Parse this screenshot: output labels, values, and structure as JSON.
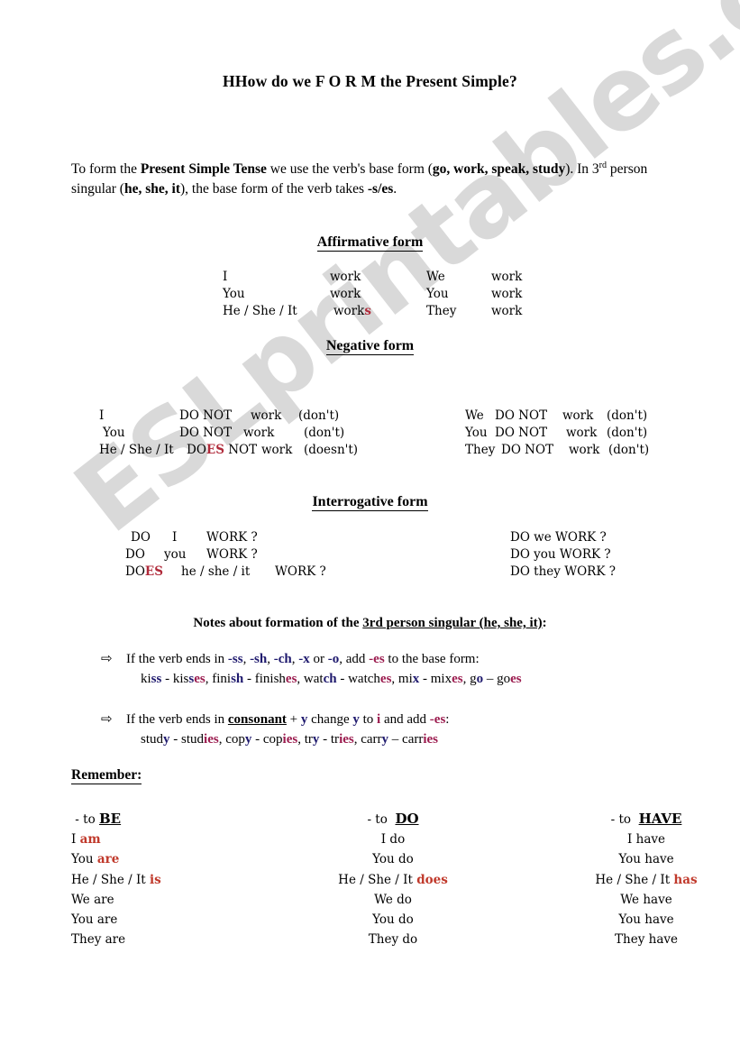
{
  "document": {
    "title": "HHow do we  F O R M  the Present Simple?",
    "watermark": "ESLprintables.com",
    "intro": {
      "part1": "To form the ",
      "bold1": "Present Simple Tense",
      "part2": " we use the verb's base form (",
      "bold2": "go, work, speak, study",
      "part3": "). In 3",
      "sup": "rd",
      "part4": " person singular (",
      "bold3": "he, she, it",
      "part5": "), the base form of the verb takes ",
      "bold4": "-s/es",
      "part6": "."
    }
  },
  "affirmative": {
    "heading": "Affirmative form",
    "left": [
      {
        "subject": "I",
        "verb": "work",
        "suffix": ""
      },
      {
        "subject": "You",
        "verb": "work",
        "suffix": ""
      },
      {
        "subject": "He / She / It",
        "verb": "work",
        "suffix": "s"
      }
    ],
    "right": [
      {
        "subject": "We",
        "verb": "work"
      },
      {
        "subject": "You",
        "verb": "work"
      },
      {
        "subject": "They",
        "verb": "work"
      }
    ]
  },
  "negative": {
    "heading": "Negative form",
    "left": [
      {
        "subject": "I",
        "aux": "DO NOT",
        "auxred": "",
        "auxtail": "",
        "verb": "work",
        "contraction": "(don't)"
      },
      {
        "subject": "You",
        "aux": "DO NOT",
        "auxred": "",
        "auxtail": "",
        "verb": "work",
        "contraction": "(don't)"
      },
      {
        "subject": "He / She / It",
        "aux": "DO",
        "auxred": "ES",
        "auxtail": " NOT",
        "verb": "work",
        "contraction": "(doesn't)"
      }
    ],
    "right": [
      {
        "subject": "We",
        "aux": "DO NOT",
        "verb": "work",
        "contraction": "(don't)"
      },
      {
        "subject": "You",
        "aux": "DO NOT",
        "verb": "work",
        "contraction": "(don't)"
      },
      {
        "subject": "They",
        "aux": "DO NOT",
        "verb": "work",
        "contraction": "(don't)"
      }
    ]
  },
  "interrogative": {
    "heading": "Interrogative form",
    "left": [
      {
        "aux": "DO",
        "auxred": "",
        "subject": "I",
        "verb": "WORK ?"
      },
      {
        "aux": "DO",
        "auxred": "",
        "subject": "you",
        "verb": "WORK ?"
      },
      {
        "aux": "DO",
        "auxred": "ES",
        "subject": "he / she / it",
        "verb": "WORK ?"
      }
    ],
    "right": [
      {
        "text": "DO we WORK ?"
      },
      {
        "text": "DO you WORK ?"
      },
      {
        "text": "DO they WORK ?"
      }
    ]
  },
  "notes": {
    "heading_plain": "Notes about formation of the ",
    "heading_underlined": "3rd person singular (he, she, it)",
    "heading_end": ":",
    "rule1": {
      "arrow": "⇨",
      "t1": "If the verb ends in ",
      "e1": "-ss",
      "t2": ", ",
      "e2": "-sh",
      "t3": ", ",
      "e3": "-ch",
      "t4": ", ",
      "e4": "-x",
      "t5": " or ",
      "e5": "-o",
      "t6": ", add ",
      "e6": "-es",
      "t7": " to the base form:",
      "examples": [
        {
          "base_start": "ki",
          "base_end": "ss",
          "sep": " - ",
          "res_start": "kis",
          "res_mid": "s",
          "res_suffix": "es",
          "tail": ", "
        },
        {
          "base_start": "fini",
          "base_end": "sh",
          "sep": " - ",
          "res_start": "finish",
          "res_mid": "",
          "res_suffix": "es",
          "tail": ", "
        },
        {
          "base_start": "wat",
          "base_end": "ch",
          "sep": " - ",
          "res_start": "watch",
          "res_mid": "",
          "res_suffix": "es",
          "tail": ", "
        },
        {
          "base_start": "mi",
          "base_end": "x",
          "sep": " - ",
          "res_start": "mix",
          "res_mid": "",
          "res_suffix": "es",
          "tail": ", "
        },
        {
          "base_start": "g",
          "base_end": "o",
          "sep": " – ",
          "res_start": "go",
          "res_mid": "",
          "res_suffix": "es",
          "tail": ""
        }
      ]
    },
    "rule2": {
      "arrow": "⇨",
      "t1": "If the verb ends in ",
      "bold_ul": "consonant",
      "t2": " + ",
      "y1": "y",
      "t3": " change ",
      "y2": "y",
      "t4": " to ",
      "i1": "i",
      "t5": " and add ",
      "e1": "-es",
      "t6": ":",
      "examples": [
        {
          "base_start": "stud",
          "base_end": "y",
          "sep": " - ",
          "res_start": "stud",
          "res_suffix": "ies",
          "tail": ", "
        },
        {
          "base_start": "cop",
          "base_end": "y",
          "sep": " - ",
          "res_start": "cop",
          "res_suffix": "ies",
          "tail": ",  "
        },
        {
          "base_start": "tr",
          "base_end": "y",
          "sep": " - ",
          "res_start": "tr",
          "res_suffix": "ies",
          "tail": ", "
        },
        {
          "base_start": "carr",
          "base_end": "y",
          "sep": " – ",
          "res_start": "carr",
          "res_suffix": "ies",
          "tail": ""
        }
      ]
    }
  },
  "remember": {
    "label": "Remember:",
    "columns": [
      {
        "head_prefix": "- to ",
        "head_verb": "BE",
        "rows": [
          {
            "subject": "I ",
            "form": "am",
            "highlight": true
          },
          {
            "subject": "You ",
            "form": "are",
            "highlight": true
          },
          {
            "subject": "He / She / It ",
            "form": "is",
            "highlight": true
          },
          {
            "subject": "We ",
            "form": "are",
            "highlight": false
          },
          {
            "subject": "You ",
            "form": "are",
            "highlight": false
          },
          {
            "subject": "They ",
            "form": "are",
            "highlight": false
          }
        ]
      },
      {
        "head_prefix": "- to  ",
        "head_verb": "DO",
        "rows": [
          {
            "subject": "I ",
            "form": "do",
            "highlight": false
          },
          {
            "subject": "You ",
            "form": "do",
            "highlight": false
          },
          {
            "subject": "He / She / It ",
            "form": "does",
            "highlight": true
          },
          {
            "subject": "We ",
            "form": "do",
            "highlight": false
          },
          {
            "subject": "You ",
            "form": "do",
            "highlight": false
          },
          {
            "subject": "They ",
            "form": "do",
            "highlight": false
          }
        ]
      },
      {
        "head_prefix": "- to  ",
        "head_verb": "HAVE",
        "rows": [
          {
            "subject": "I ",
            "form": "have",
            "highlight": false
          },
          {
            "subject": "You ",
            "form": "have",
            "highlight": false
          },
          {
            "subject": "He / She / It ",
            "form": "has",
            "highlight": true
          },
          {
            "subject": "We ",
            "form": "have",
            "highlight": false
          },
          {
            "subject": "You ",
            "form": "have",
            "highlight": false
          },
          {
            "subject": "They ",
            "form": "have",
            "highlight": false
          }
        ]
      }
    ]
  },
  "colors": {
    "red_accent": "#b02a3a",
    "navy_accent": "#1f1a6e",
    "crimson_accent": "#9b1b4e",
    "watermark_gray": "#d9d9d9"
  }
}
